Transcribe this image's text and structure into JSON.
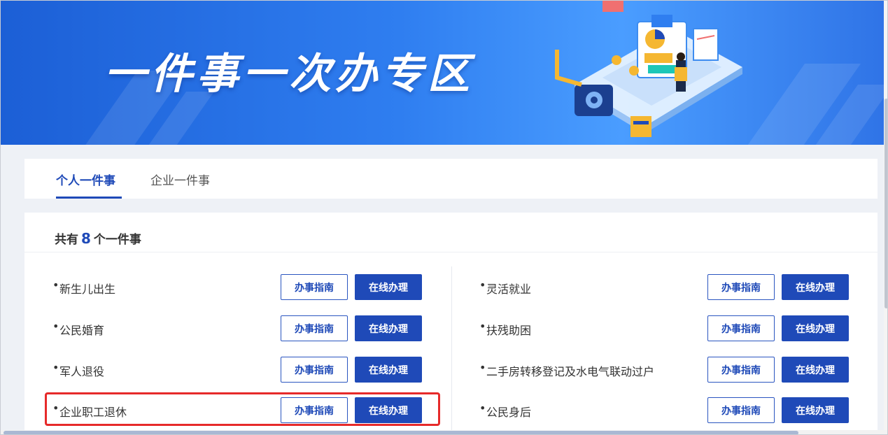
{
  "banner": {
    "title": "一件事一次办专区"
  },
  "tabs": [
    {
      "label": "个人一件事",
      "active": true
    },
    {
      "label": "企业一件事",
      "active": false
    }
  ],
  "summary": {
    "prefix": "共有",
    "count": "8",
    "suffix": "个一件事"
  },
  "buttons": {
    "guide": "办事指南",
    "online": "在线办理"
  },
  "items_left": [
    {
      "name": "新生儿出生"
    },
    {
      "name": "公民婚育"
    },
    {
      "name": "军人退役"
    },
    {
      "name": "企业职工退休",
      "highlighted": true
    }
  ],
  "items_right": [
    {
      "name": "灵活就业"
    },
    {
      "name": "扶残助困"
    },
    {
      "name": "二手房转移登记及水电气联动过户"
    },
    {
      "name": "公民身后"
    }
  ],
  "colors": {
    "accent": "#1f4ab8",
    "banner": "#2f7ef0",
    "highlight": "#e62a2a"
  }
}
